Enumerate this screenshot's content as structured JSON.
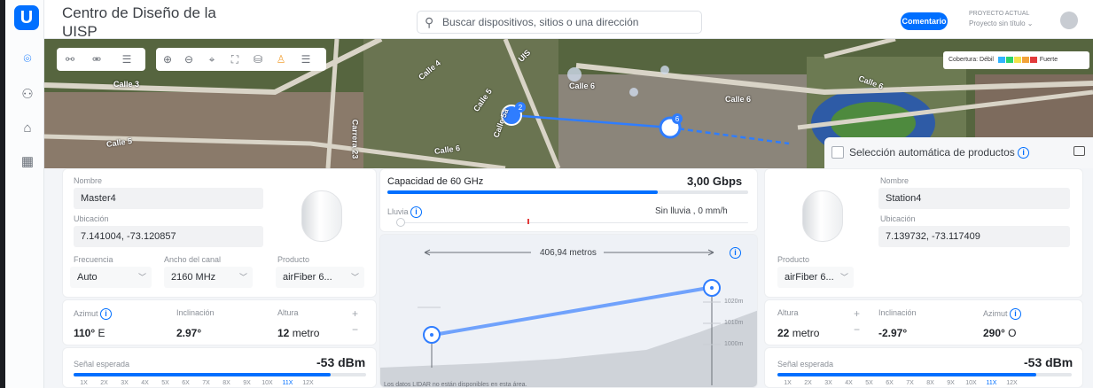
{
  "header": {
    "app_title": "Centro de Diseño de la UISP",
    "search_placeholder": "Buscar dispositivos, sitios o una dirección",
    "comment_label": "Comentario",
    "project_label": "PROYECTO ACTUAL",
    "project_name": "Proyecto sin título ⌄"
  },
  "sidebar": {
    "logo": "U",
    "items": [
      {
        "icon": "map-pin-icon",
        "glyph": "⌾"
      },
      {
        "icon": "topology-icon",
        "glyph": "⚇"
      },
      {
        "icon": "router-icon",
        "glyph": "⌂"
      },
      {
        "icon": "calculator-icon",
        "glyph": "▦"
      }
    ]
  },
  "map": {
    "coverage_label": "Cobertura: Débil",
    "coverage_strong": "Fuerte",
    "coverage_colors": [
      "#2fb3ff",
      "#2bd36a",
      "#f2e24a",
      "#f2a33a",
      "#e23b3b"
    ],
    "streets": [
      "Calle 3",
      "Calle 5",
      "Calle 4",
      "Calle 5",
      "Calle 6",
      "Calle 6",
      "Calle 6",
      "Calle 6",
      "Calle 5a",
      "UIS",
      "Carrera 23"
    ],
    "link_badge_a": "2",
    "link_badge_b": "6",
    "auto_select_label": "Selección automática de productos"
  },
  "master": {
    "name_label": "Nombre",
    "name": "Master4",
    "location_label": "Ubicación",
    "location": "7.141004, -73.120857",
    "freq_label": "Frecuencia",
    "freq": "Auto",
    "channel_label": "Ancho del canal",
    "channel": "2160 MHz",
    "product_label": "Producto",
    "product": "airFiber 6...",
    "azimuth_label": "Azimut",
    "azimuth": "110°",
    "azimuth_dir": "E",
    "tilt_label": "Inclinación",
    "tilt": "2.97°",
    "height_label": "Altura",
    "height_value": "12",
    "height_unit": "metro",
    "signal_label": "Señal esperada",
    "signal": "-53 dBm",
    "signal_fill": 0.88
  },
  "station": {
    "name_label": "Nombre",
    "name": "Station4",
    "location_label": "Ubicación",
    "location": "7.139732, -73.117409",
    "product_label": "Producto",
    "product": "airFiber 6...",
    "height_label": "Altura",
    "height_value": "22",
    "height_unit": "metro",
    "tilt_label": "Inclinación",
    "tilt": "-2.97°",
    "azimuth_label": "Azimut",
    "azimuth": "290°",
    "azimuth_dir": "O",
    "signal_label": "Señal esperada",
    "signal": "-53 dBm",
    "signal_fill": 0.88
  },
  "link": {
    "capacity_label": "Capacidad de 60 GHz",
    "capacity": "3,00 Gbps",
    "capacity_fill": 0.75,
    "rain_label": "Lluvia",
    "rain_value": "Sin lluvia , 0 mm/h",
    "distance": "406,94 metros",
    "elevations": [
      "1020m",
      "1010m",
      "1000m"
    ],
    "lidar_note": "Los datos LIDAR no están disponibles en esta área."
  },
  "scale": [
    "1X",
    "2X",
    "3X",
    "4X",
    "5X",
    "6X",
    "7X",
    "8X",
    "9X",
    "10X",
    "11X",
    "12X"
  ],
  "scale_selected": "11X"
}
